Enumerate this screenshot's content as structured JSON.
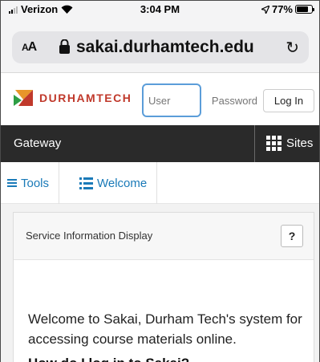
{
  "status_bar": {
    "carrier": "Verizon",
    "time": "3:04 PM",
    "battery": "77%",
    "battery_level": 0.77
  },
  "address_bar": {
    "text_size_label": "AA",
    "url": "sakai.durhamtech.edu",
    "icons": [
      "lock-icon",
      "reload-icon"
    ]
  },
  "header": {
    "logo_text": "DURHAMTECH",
    "user_placeholder": "User",
    "password_placeholder": "Password",
    "login_label": "Log In"
  },
  "nav": {
    "gateway_label": "Gateway",
    "sites_label": "Sites"
  },
  "tabs": [
    {
      "label": "Tools"
    },
    {
      "label": "Welcome"
    }
  ],
  "panel": {
    "title": "Service Information Display",
    "help_label": "?",
    "welcome_text": "Welcome to Sakai, Durham Tech's system for accessing course materials online.",
    "subheading": "How do I log in to Sakai?"
  },
  "colors": {
    "accent_blue": "#1a7ab8",
    "logo_red": "#c0392b",
    "logo_green": "#2e9e44",
    "logo_orange": "#e8962a",
    "nav_dark": "#2a2a2a",
    "input_focus": "#5b9dd9"
  }
}
